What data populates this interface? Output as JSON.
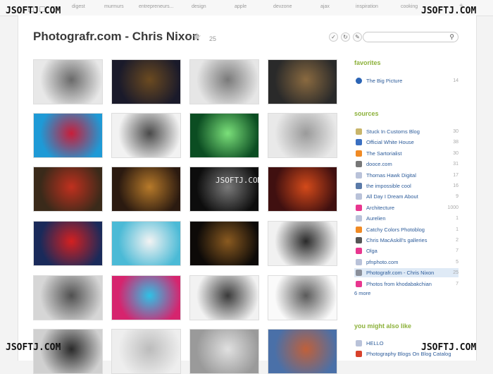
{
  "topbar": {
    "nav": [
      "digest",
      "murmurs",
      "entrepreneurs...",
      "design",
      "apple",
      "devzone",
      "ajax",
      "inspiration",
      "cooking"
    ]
  },
  "header": {
    "title": "Photografr.com - Chris Nixon",
    "count": "25"
  },
  "favorites": {
    "heading": "favorites",
    "items": [
      {
        "label": "The Big Picture",
        "count": "14",
        "color": "#2b64b5"
      }
    ]
  },
  "sources": {
    "heading": "sources",
    "items": [
      {
        "label": "Stuck In Customs Blog",
        "count": "30",
        "color": "#c9b56a"
      },
      {
        "label": "Official White House",
        "count": "38",
        "color": "#3a6fc1"
      },
      {
        "label": "The Sartorialist",
        "count": "30",
        "color": "#f08a24"
      },
      {
        "label": "dooce.com",
        "count": "31",
        "color": "#777777"
      },
      {
        "label": "Thomas Hawk Digital",
        "count": "17",
        "color": "#b9c2d9"
      },
      {
        "label": "the impossible cool",
        "count": "16",
        "color": "#5a7aa8"
      },
      {
        "label": "All Day I Dream About",
        "count": "9",
        "color": "#b9c2d9"
      },
      {
        "label": "Architecture",
        "count": "1000",
        "color": "#e8368f"
      },
      {
        "label": "Aurelien",
        "count": "1",
        "color": "#b9c2d9"
      },
      {
        "label": "Catchy Colors Photoblog",
        "count": "1",
        "color": "#f08a24"
      },
      {
        "label": "Chris MacAskill's galleries",
        "count": "2",
        "color": "#555555"
      },
      {
        "label": "Olga",
        "count": "7",
        "color": "#e8368f"
      },
      {
        "label": "pfnphoto.com",
        "count": "5",
        "color": "#b9c2d9"
      },
      {
        "label": "Photografr.com - Chris Nixon",
        "count": "25",
        "color": "#8a8f9a"
      },
      {
        "label": "Photos from khodabakchian",
        "count": "7",
        "color": "#e8368f"
      }
    ],
    "more": "6 more"
  },
  "suggest": {
    "heading": "you might also like",
    "items": [
      {
        "label": "HELLO",
        "color": "#b9c2d9"
      },
      {
        "label": "Photography Blogs On Blog Catalog",
        "color": "#d8412b"
      }
    ]
  },
  "watermark": {
    "text": "JSOFTJ.COM",
    "center": "JSOFTJ.COM"
  },
  "photos": [
    {
      "c1": "#e8e8e8",
      "c2": "#6a6a6a"
    },
    {
      "c1": "#1a1a2a",
      "c2": "#6b4a20"
    },
    {
      "c1": "#e6e6e6",
      "c2": "#7a7a7a"
    },
    {
      "c1": "#2a2a2a",
      "c2": "#8a6a40"
    },
    {
      "c1": "#1e9ad6",
      "c2": "#c81e3a"
    },
    {
      "c1": "#f2f2f2",
      "c2": "#4a4a4a"
    },
    {
      "c1": "#0b4d22",
      "c2": "#7be07a"
    },
    {
      "c1": "#e9e9e9",
      "c2": "#9a9a9a"
    },
    {
      "c1": "#3a2a1a",
      "c2": "#c0301e"
    },
    {
      "c1": "#2b1a10",
      "c2": "#b77a2a"
    },
    {
      "c1": "#0d0d0d",
      "c2": "#7a7a7a"
    },
    {
      "c1": "#401010",
      "c2": "#d44a1a"
    },
    {
      "c1": "#1a2a5a",
      "c2": "#d42020"
    },
    {
      "c1": "#4bbad6",
      "c2": "#f3f3f3"
    },
    {
      "c1": "#0d0a08",
      "c2": "#8a5a20"
    },
    {
      "c1": "#f1f1f1",
      "c2": "#2a2a2a"
    },
    {
      "c1": "#d6d6d6",
      "c2": "#505050"
    },
    {
      "c1": "#d6246e",
      "c2": "#2ec2e6"
    },
    {
      "c1": "#f2f2f2",
      "c2": "#3a3a3a"
    },
    {
      "c1": "#fafafa",
      "c2": "#5a5a5a"
    },
    {
      "c1": "#d0d0d0",
      "c2": "#2a2a2a"
    },
    {
      "c1": "#eeeeee",
      "c2": "#bcbcbc"
    },
    {
      "c1": "#9a9a9a",
      "c2": "#e0e0e0"
    },
    {
      "c1": "#4a70a8",
      "c2": "#c0603a"
    }
  ]
}
